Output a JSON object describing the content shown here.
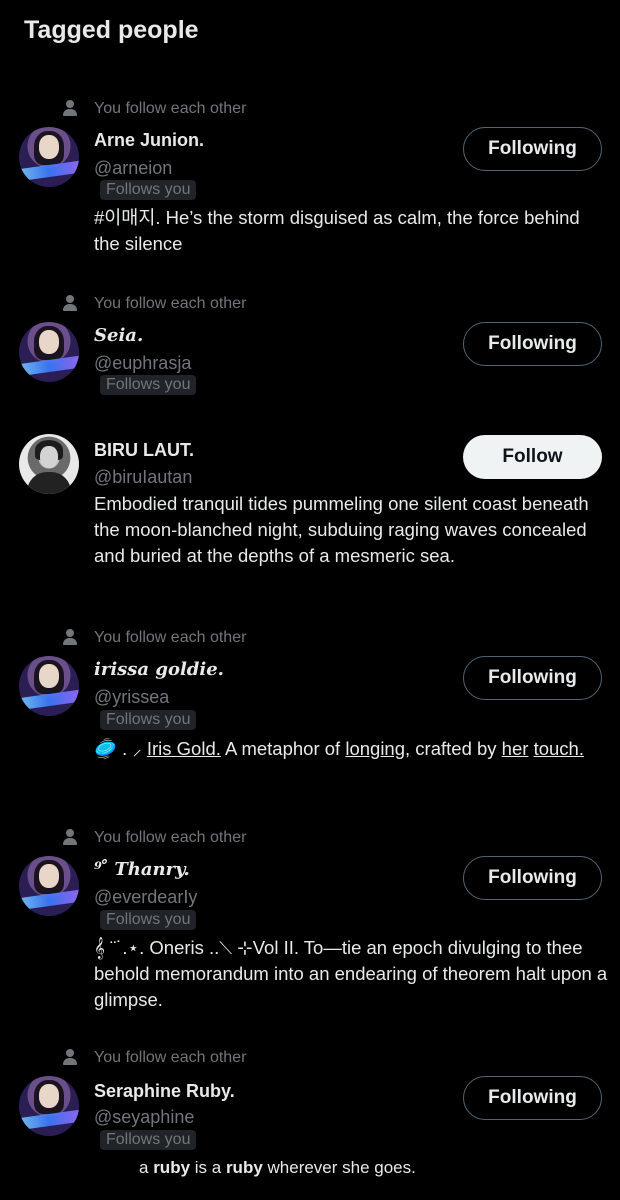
{
  "page": {
    "title": "Tagged people"
  },
  "people": [
    {
      "context": "You follow each other",
      "name": "Arne Junion.",
      "handle": "@arneion",
      "badge": "Follows you",
      "button": "Following",
      "bio": "#이매지. He’s the storm disguised as calm, the force behind the silence"
    },
    {
      "context": "You follow each other",
      "name": "Seia.",
      "handle": "@euphrasja",
      "badge": "Follows you",
      "button": "Following"
    },
    {
      "name": "BIRU LAUT.",
      "handle": "@biruIautan",
      "button": "Follow",
      "bio": "Embodied tranquil tides pummeling one silent coast beneath the moon-blanched night, subduing raging waves concealed and buried at the depths of a mesmeric sea."
    },
    {
      "context": "You follow each other",
      "name": "irissa goldie.",
      "handle": "@yrissea",
      "badge": "Follows you",
      "button": "Following",
      "bio_parts": {
        "lead": "🥏   . ⸝ ",
        "iris": "Iris Gold.",
        "mid": "   A metaphor of ",
        "longing": "longing,",
        "crafted": " crafted by ",
        "her": "her",
        "touch": "touch."
      }
    },
    {
      "context": "You follow each other",
      "name": "⁹ ̊ Thanry.",
      "handle": "@everdearIy",
      "badge": "Follows you",
      "button": "Following",
      "bio": "𝄞 ¨˙.⋆. Oneris ..⟍   ⊹Vol II.  To—tie an epoch divulging to thee behold memorandum into an endearing of theorem halt upon a glimpse."
    },
    {
      "context": "You follow each other",
      "name": "Seraphine Ruby.",
      "handle": "@seyaphine",
      "badge": "Follows you",
      "button": "Following",
      "bio_parts": {
        "a1": "a ",
        "ruby1": "ruby",
        "is": " is a ",
        "ruby2": "ruby",
        "rest": " wherever she goes."
      }
    }
  ]
}
